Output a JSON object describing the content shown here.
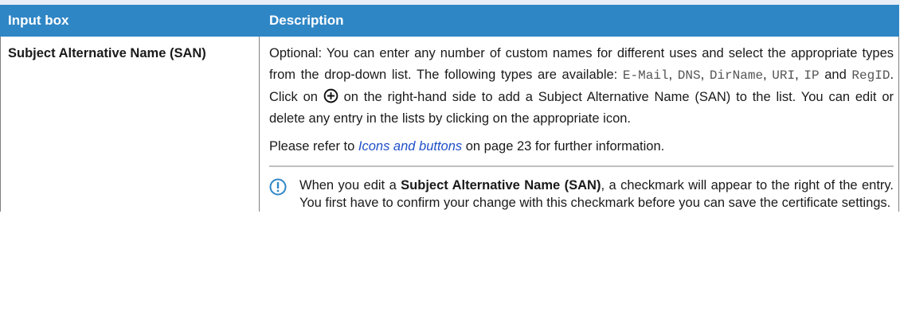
{
  "header": {
    "col1": "Input box",
    "col2": "Description"
  },
  "row": {
    "field_name": "Subject Alternative Name (SAN)",
    "p1": {
      "t1": "Optional: You can enter any number of custom names for different uses and select the appropriate types from the drop-down list. The following types are available: ",
      "type1": "E-Mail",
      "sep1": ", ",
      "type2": "DNS",
      "sep2": ", ",
      "type3": "DirName",
      "sep3": ", ",
      "type4": "URI",
      "sep4": ", ",
      "type5": "IP",
      "and": " and ",
      "type6": "RegID",
      "t2": ". Click on ",
      "icon": "plus-circle-icon",
      "t3": " on the right-hand side to add a Subject Alternative Name (SAN) to the list. You can edit or delete any entry in the lists by clicking on the appropriate icon."
    },
    "p2": {
      "t1": "Please refer to ",
      "link": "Icons and buttons",
      "t2": " on page 23 for further information."
    },
    "note": {
      "icon": "exclamation-circle-icon",
      "t1": "When you edit a ",
      "bold": "Subject Alternative Name (SAN)",
      "t2": ", a checkmark will appear to the right of the entry. You first have to confirm your change with this checkmark before you can save the certificate settings."
    }
  },
  "colors": {
    "header_bg": "#2f86c5",
    "link": "#1f4fc8",
    "note_icon": "#2f86c5"
  }
}
